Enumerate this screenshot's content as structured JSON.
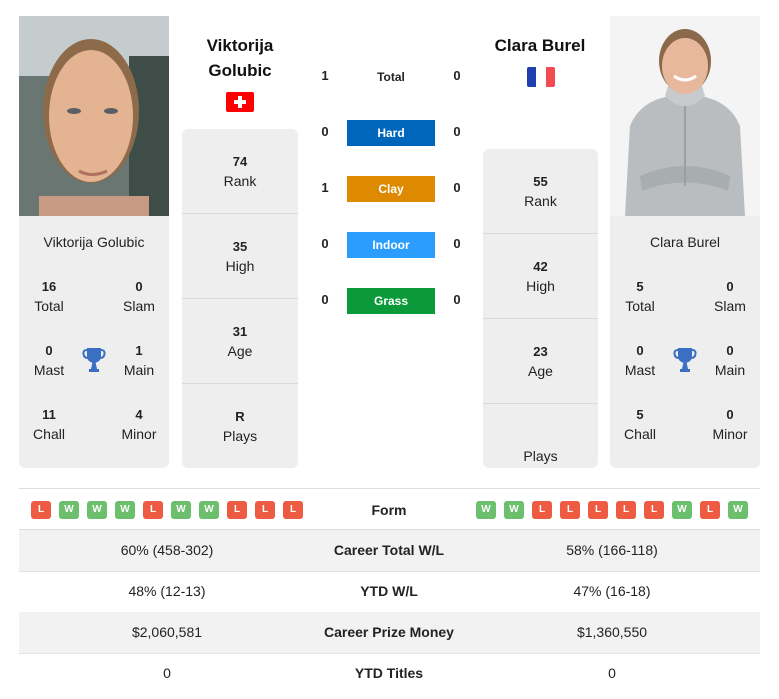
{
  "player1": {
    "name": "Viktorija Golubic",
    "name_line1": "Viktorija",
    "name_line2": "Golubic",
    "country_flag": "switzerland-flag",
    "photo": "player-photo",
    "titles": {
      "total": {
        "value": "16",
        "label": "Total"
      },
      "slam": {
        "value": "0",
        "label": "Slam"
      },
      "mast": {
        "value": "0",
        "label": "Mast"
      },
      "main": {
        "value": "1",
        "label": "Main"
      },
      "chall": {
        "value": "11",
        "label": "Chall"
      },
      "minor": {
        "value": "4",
        "label": "Minor"
      }
    },
    "rank": {
      "value": "74",
      "label": "Rank"
    },
    "high": {
      "value": "35",
      "label": "High"
    },
    "age": {
      "value": "31",
      "label": "Age"
    },
    "plays": {
      "value": "R",
      "label": "Plays"
    },
    "form": [
      "L",
      "W",
      "W",
      "W",
      "L",
      "W",
      "W",
      "L",
      "L",
      "L"
    ]
  },
  "player2": {
    "name": "Clara Burel",
    "country_flag": "france-flag",
    "photo": "player-photo",
    "titles": {
      "total": {
        "value": "5",
        "label": "Total"
      },
      "slam": {
        "value": "0",
        "label": "Slam"
      },
      "mast": {
        "value": "0",
        "label": "Mast"
      },
      "main": {
        "value": "0",
        "label": "Main"
      },
      "chall": {
        "value": "5",
        "label": "Chall"
      },
      "minor": {
        "value": "0",
        "label": "Minor"
      }
    },
    "rank": {
      "value": "55",
      "label": "Rank"
    },
    "high": {
      "value": "42",
      "label": "High"
    },
    "age": {
      "value": "23",
      "label": "Age"
    },
    "plays": {
      "value": "",
      "label": "Plays"
    },
    "form": [
      "W",
      "W",
      "L",
      "L",
      "L",
      "L",
      "L",
      "W",
      "L",
      "W"
    ]
  },
  "h2h": [
    {
      "label": "Total",
      "p1": "1",
      "p2": "0",
      "color": ""
    },
    {
      "label": "Hard",
      "p1": "0",
      "p2": "0",
      "color": "#0066bb"
    },
    {
      "label": "Clay",
      "p1": "1",
      "p2": "0",
      "color": "#dd8a00"
    },
    {
      "label": "Indoor",
      "p1": "0",
      "p2": "0",
      "color": "#2a9dff"
    },
    {
      "label": "Grass",
      "p1": "0",
      "p2": "0",
      "color": "#0b9a3a"
    }
  ],
  "form_label": "Form",
  "stats": [
    {
      "label": "Career Total W/L",
      "p1": "60% (458-302)",
      "p2": "58% (166-118)"
    },
    {
      "label": "YTD W/L",
      "p1": "48% (12-13)",
      "p2": "47% (16-18)"
    },
    {
      "label": "Career Prize Money",
      "p1": "$2,060,581",
      "p2": "$1,360,550"
    },
    {
      "label": "YTD Titles",
      "p1": "0",
      "p2": "0"
    }
  ],
  "colors": {
    "win": "#6cbf6c",
    "loss": "#ee5b43",
    "trophy": "#3a6fc4",
    "card_bg": "#eeeeee"
  }
}
